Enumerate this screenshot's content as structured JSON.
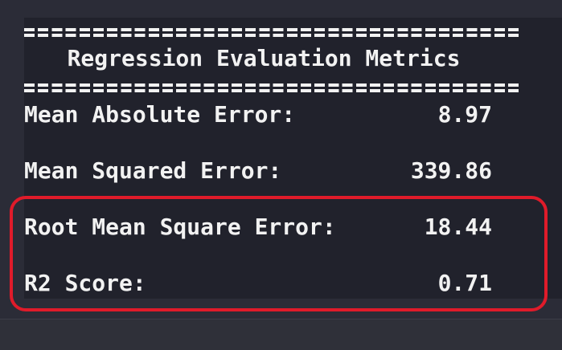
{
  "report": {
    "separator": "=================================",
    "title": "Regression Evaluation Metrics",
    "metrics": [
      {
        "label": "Mean Absolute Error:",
        "value": "8.97"
      },
      {
        "label": "Mean Squared Error:",
        "value": "339.86"
      },
      {
        "label": "Root Mean Square Error:",
        "value": "18.44"
      },
      {
        "label": "R2 Score:",
        "value": "0.71"
      }
    ]
  },
  "colors": {
    "background": "#2b2c37",
    "panel": "#21222c",
    "text": "#f2f2f2",
    "highlight": "#e01b2a"
  }
}
